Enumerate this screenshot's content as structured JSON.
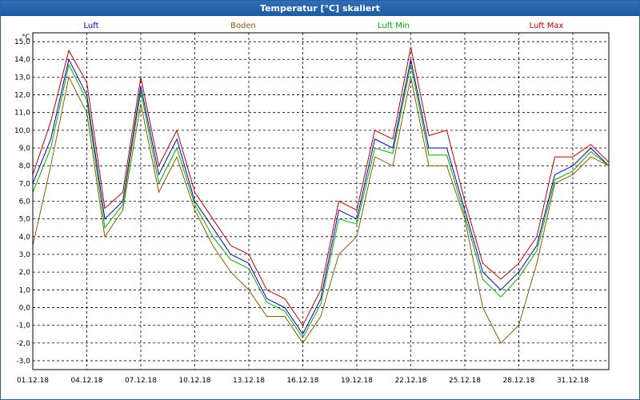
{
  "window": {
    "title": "Temperatur [°C] skaliert"
  },
  "chart_data": {
    "type": "line",
    "title": "Temperatur [°C] skaliert",
    "ylabel": "°C",
    "ylim": [
      -3.5,
      15.5
    ],
    "yticks": [
      -3.0,
      -2.0,
      -1.0,
      0.0,
      1.0,
      2.0,
      3.0,
      4.0,
      5.0,
      6.0,
      7.0,
      8.0,
      9.0,
      10.0,
      11.0,
      12.0,
      13.0,
      14.0,
      15.0
    ],
    "ytick_labels": [
      "-3,0",
      "-2,0",
      "-1,0",
      "0,0",
      "1,0",
      "2,0",
      "3,0",
      "4,0",
      "5,0",
      "6,0",
      "7,0",
      "8,0",
      "9,0",
      "10,0",
      "11,0",
      "12,0",
      "13,0",
      "14,0",
      "15,0"
    ],
    "xlim": [
      "01.12.18",
      "02.01.19"
    ],
    "xtick_labels": [
      "01.12.18",
      "04.12.18",
      "07.12.18",
      "10.12.18",
      "13.12.18",
      "16.12.18",
      "19.12.18",
      "22.12.18",
      "25.12.18",
      "28.12.18",
      "31.12.18"
    ],
    "grid": true,
    "legend_position": "top",
    "x": [
      "01.12.18",
      "02.12.18",
      "03.12.18",
      "04.12.18",
      "05.12.18",
      "06.12.18",
      "07.12.18",
      "08.12.18",
      "09.12.18",
      "10.12.18",
      "11.12.18",
      "12.12.18",
      "13.12.18",
      "14.12.18",
      "15.12.18",
      "16.12.18",
      "17.12.18",
      "18.12.18",
      "19.12.18",
      "20.12.18",
      "21.12.18",
      "22.12.18",
      "23.12.18",
      "24.12.18",
      "25.12.18",
      "26.12.18",
      "27.12.18",
      "28.12.18",
      "29.12.18",
      "30.12.18",
      "31.12.18",
      "01.01.19",
      "02.01.19"
    ],
    "series": [
      {
        "name": "Luft",
        "color": "#0000c0",
        "values": [
          7.0,
          9.5,
          14.0,
          12.0,
          5.0,
          6.0,
          12.5,
          7.5,
          9.5,
          6.0,
          4.5,
          3.0,
          2.5,
          0.5,
          0.0,
          -1.5,
          0.5,
          5.5,
          5.0,
          9.5,
          9.0,
          14.0,
          9.0,
          9.0,
          5.5,
          2.0,
          1.0,
          2.0,
          3.5,
          7.5,
          8.0,
          9.0,
          8.0
        ]
      },
      {
        "name": "Boden",
        "color": "#8b5a00",
        "values": [
          3.5,
          8.0,
          13.0,
          11.0,
          4.0,
          5.5,
          11.5,
          6.5,
          8.5,
          5.5,
          3.5,
          2.0,
          1.0,
          -0.5,
          -0.5,
          -2.0,
          -0.5,
          3.0,
          4.0,
          8.5,
          8.0,
          13.0,
          8.0,
          8.0,
          5.0,
          0.0,
          -2.0,
          -1.0,
          2.5,
          7.0,
          7.5,
          8.5,
          8.0
        ]
      },
      {
        "name": "Luft Min",
        "color": "#00b000",
        "values": [
          6.5,
          9.0,
          13.7,
          11.7,
          4.5,
          5.8,
          12.2,
          7.0,
          9.0,
          5.8,
          4.0,
          2.7,
          2.2,
          0.3,
          -0.2,
          -1.7,
          0.2,
          5.0,
          4.7,
          9.0,
          8.7,
          13.7,
          8.6,
          8.6,
          5.2,
          1.6,
          0.6,
          1.7,
          3.2,
          7.2,
          7.7,
          8.8,
          8.0
        ]
      },
      {
        "name": "Luft Max",
        "color": "#c00000",
        "values": [
          7.5,
          10.5,
          14.5,
          12.7,
          5.6,
          6.5,
          13.0,
          8.0,
          10.0,
          6.5,
          5.0,
          3.5,
          3.0,
          1.0,
          0.5,
          -1.0,
          1.0,
          6.0,
          5.5,
          10.0,
          9.5,
          14.7,
          9.7,
          10.0,
          6.0,
          2.5,
          1.6,
          2.5,
          4.0,
          8.5,
          8.5,
          9.2,
          8.2
        ]
      }
    ]
  }
}
